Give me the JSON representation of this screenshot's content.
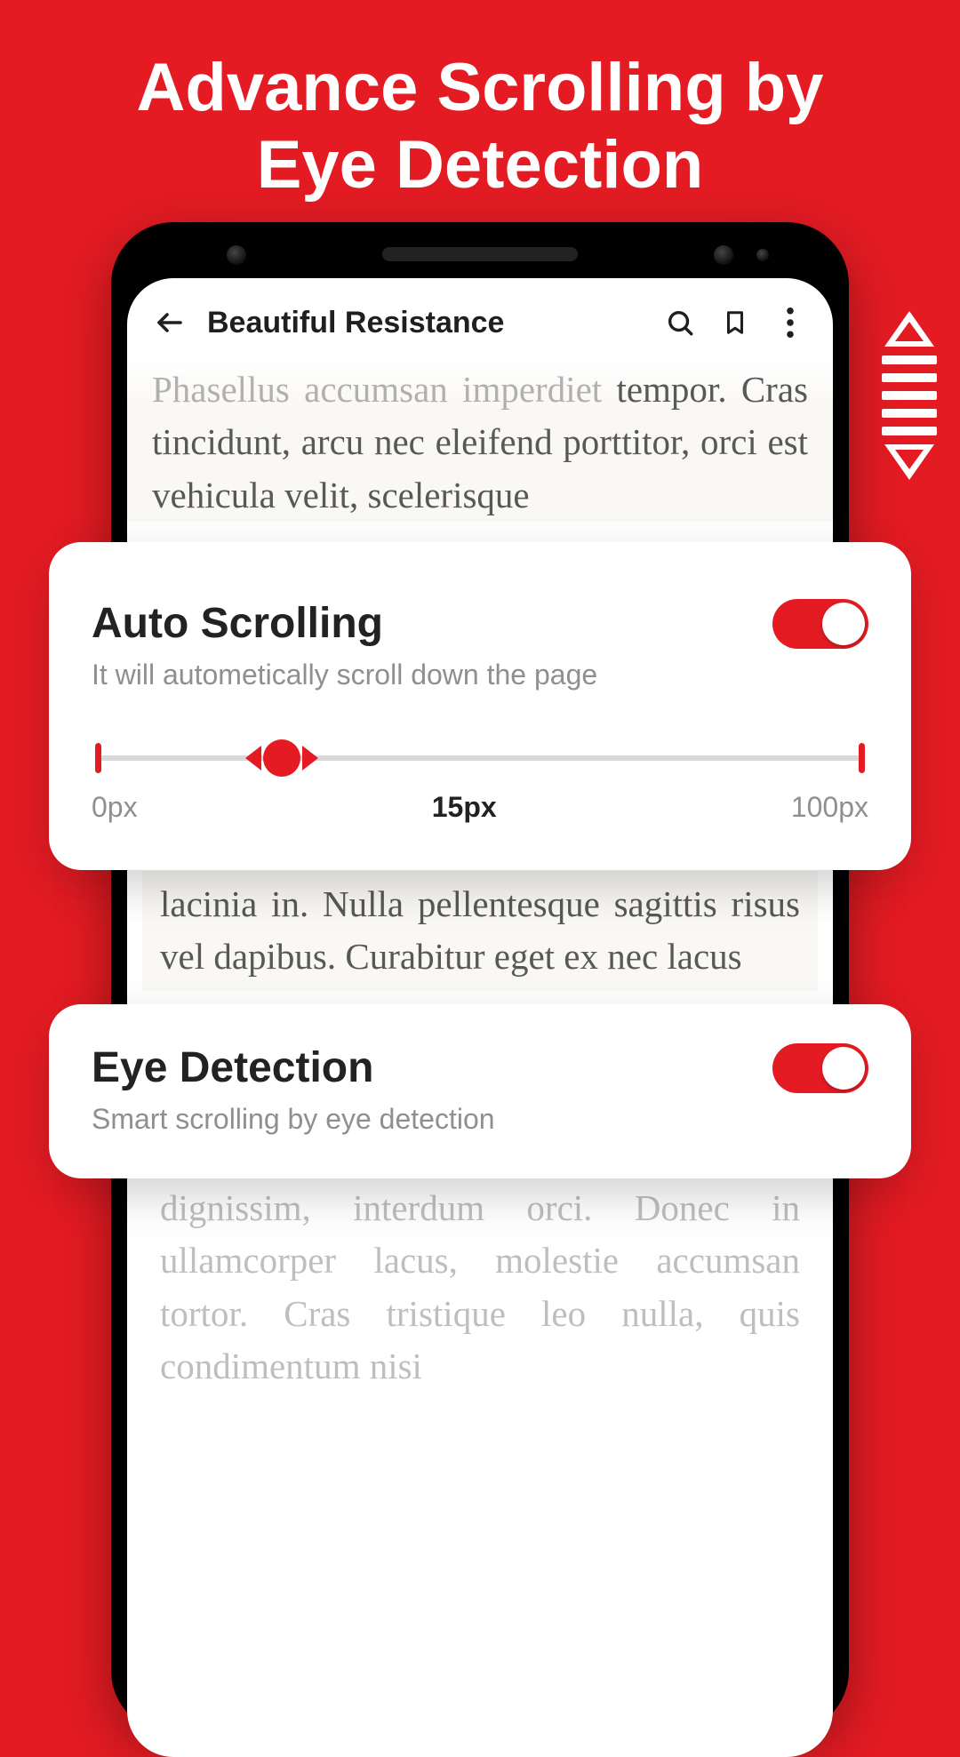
{
  "hero": {
    "line1": "Advance Scrolling by",
    "line2": "Eye Detection"
  },
  "reader": {
    "title": "Beautiful Resistance",
    "body_top_faded": "Phasellus accumsan imperdiet",
    "body_top": "tempor. Cras tincidunt, arcu nec eleifend porttitor, orci est vehicula velit, scelerisque",
    "body_mid": "lacinia in. Nulla pellentesque sagittis risus vel dapibus. Curabitur eget ex nec lacus",
    "body_bottom": "dignissim, interdum orci. Donec in ullamcorper lacus, molestie accumsan tortor. Cras tristique leo nulla, quis condimentum nisi"
  },
  "settings": {
    "auto_scrolling": {
      "title": "Auto Scrolling",
      "subtitle": "It will autometically scroll down the page",
      "enabled": true,
      "slider": {
        "min_label": "0px",
        "current_label": "15px",
        "max_label": "100px",
        "percent": 24
      }
    },
    "eye_detection": {
      "title": "Eye Detection",
      "subtitle": "Smart scrolling by eye detection",
      "enabled": true
    }
  }
}
